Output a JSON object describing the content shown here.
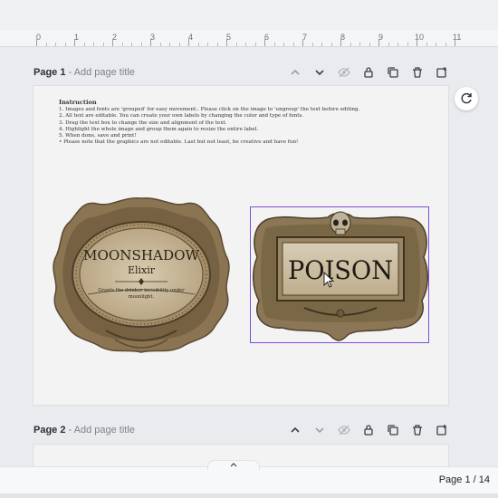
{
  "ruler": {
    "numbers": [
      "0",
      "1",
      "2",
      "3",
      "4",
      "5",
      "6",
      "7",
      "8",
      "9",
      "10",
      "11"
    ]
  },
  "pages": [
    {
      "label": "Page 1",
      "separator": " - ",
      "add_title": "Add page title"
    },
    {
      "label": "Page 2",
      "separator": " - ",
      "add_title": "Add page title"
    }
  ],
  "page_toolbar_icons": [
    "chevron-up-icon",
    "chevron-down-icon",
    "hide-icon",
    "lock-icon",
    "duplicate-icon",
    "trash-icon",
    "add-page-icon"
  ],
  "instructions": {
    "heading": "Instruction",
    "lines": [
      "1. Images and fonts are 'grouped' for easy movement.. Please click on the image to 'ungroup' the text before editing.",
      "2. All text are editable. You can create your own labels by changing the color and type of fonts.",
      "3. Drag the text box to change the size and alignment of the text.",
      "4. Highlight the whole image and group them again to resize the entire label.",
      "5. When done, save and print!",
      "• Please note that the graphics are not editable. Last but not least, be creative and have fun!"
    ]
  },
  "label_left": {
    "title": "MOONSHADOW",
    "subtitle": "Elixir",
    "description_line1": "Grants the drinker invisibility under",
    "description_line2": "moonlight."
  },
  "label_right": {
    "title": "POISON"
  },
  "footer": {
    "page_count": "Page 1 / 14",
    "collapse_icon": "chevron-up-icon"
  },
  "colors": {
    "selection": "#7d4dd8",
    "label_parchment": "#cdbfa3",
    "label_frame": "#6e5a3d"
  }
}
